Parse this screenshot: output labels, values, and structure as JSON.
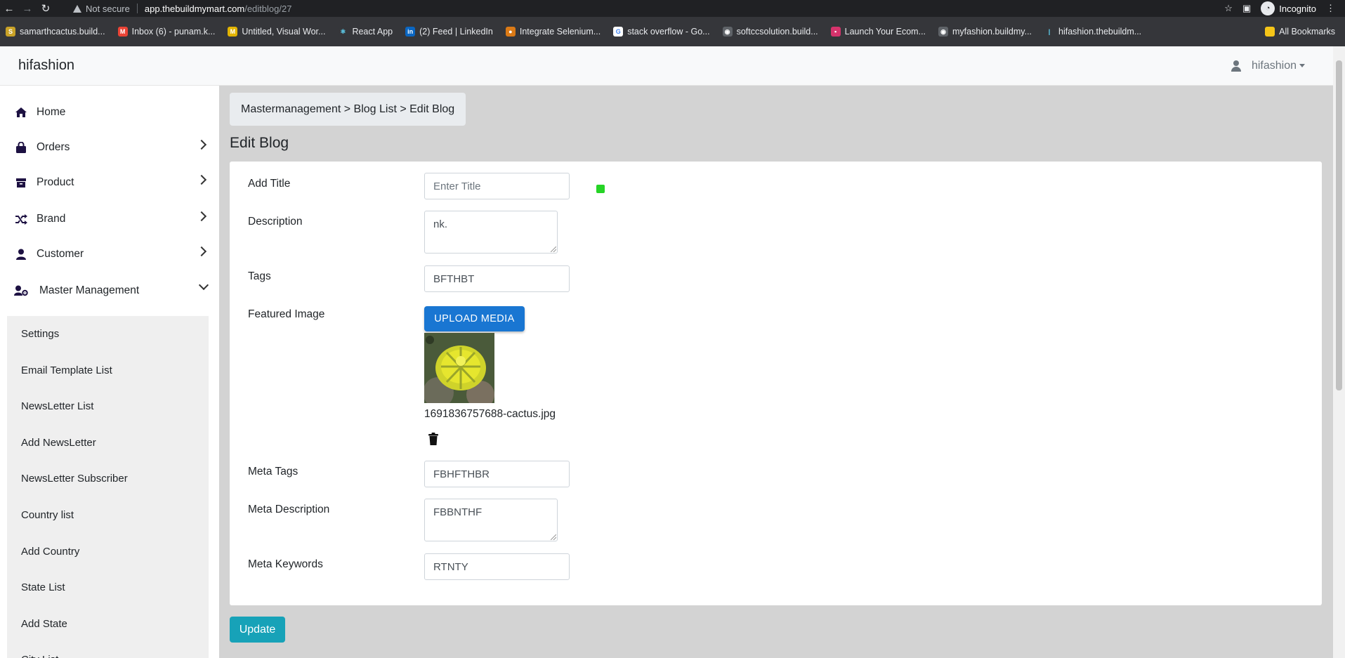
{
  "browser": {
    "not_secure": "Not secure",
    "url_host": "app.thebuildmymart.com",
    "url_path": "/editblog/27",
    "incognito": "Incognito"
  },
  "bookmarks": [
    {
      "label": "samarthcactus.build...",
      "icon": "S",
      "color": "#c9a227"
    },
    {
      "label": "Inbox (6) - punam.k...",
      "icon": "M",
      "color": "#ea4335"
    },
    {
      "label": "Untitled, Visual Wor...",
      "icon": "M",
      "color": "#e2b400"
    },
    {
      "label": "React App",
      "icon": "⚛",
      "color": "#35363a"
    },
    {
      "label": "(2) Feed | LinkedIn",
      "icon": "in",
      "color": "#0a66c2"
    },
    {
      "label": "Integrate Selenium...",
      "icon": "●",
      "color": "#db7a16"
    },
    {
      "label": "stack overflow - Go...",
      "icon": "G",
      "color": "#ffffff"
    },
    {
      "label": "softccsolution.build...",
      "icon": "◉",
      "color": "#5f6368"
    },
    {
      "label": "Launch Your Ecom...",
      "icon": "▪",
      "color": "#d6336c"
    },
    {
      "label": "myfashion.buildmy...",
      "icon": "◉",
      "color": "#5f6368"
    },
    {
      "label": "hifashion.thebuildm...",
      "icon": "|",
      "color": "#35363a"
    }
  ],
  "all_bookmarks": "All Bookmarks",
  "app": {
    "brand": "hifashion",
    "user": "hifashion"
  },
  "sidebar": {
    "items": [
      {
        "label": "Home",
        "icon": "home-icon"
      },
      {
        "label": "Orders",
        "icon": "shopping-bag-icon"
      },
      {
        "label": "Product",
        "icon": "box-icon"
      },
      {
        "label": "Brand",
        "icon": "shuffle-icon"
      },
      {
        "label": "Customer",
        "icon": "user-icon"
      },
      {
        "label": "Master Management",
        "icon": "user-gear-icon"
      }
    ],
    "submenu": [
      "Settings",
      "Email Template List",
      "NewsLetter List",
      "Add NewsLetter",
      "NewsLetter Subscriber",
      "Country list",
      "Add Country",
      "State List",
      "Add State",
      "City List"
    ]
  },
  "breadcrumb": "Mastermanagement > Blog List > Edit Blog",
  "page_title": "Edit Blog",
  "form": {
    "title_label": "Add Title",
    "title_placeholder": "Enter Title",
    "description_label": "Description",
    "description_value": "nk.",
    "tags_label": "Tags",
    "tags_value": "BFTHBT",
    "featured_label": "Featured Image",
    "upload_label": "UPLOAD MEDIA",
    "file_name": "1691836757688-cactus.jpg",
    "meta_tags_label": "Meta Tags",
    "meta_tags_value": "FBHFTHBR",
    "meta_desc_label": "Meta Description",
    "meta_desc_value": "FBBNTHF",
    "meta_keywords_label": "Meta Keywords",
    "meta_keywords_value": "RTNTY"
  },
  "update_label": "Update",
  "colors": {
    "upload": "#1976d2",
    "update": "#17a2b8",
    "status": "#26d426"
  }
}
